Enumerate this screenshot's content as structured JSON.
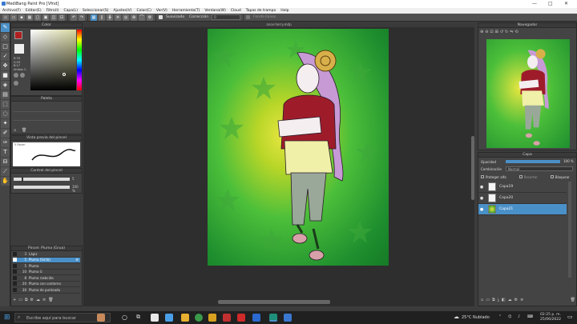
{
  "window": {
    "title": "MediBang Paint Pro [Vfnd]",
    "controls": [
      "—",
      "□",
      "✕"
    ]
  },
  "menu": [
    "Archivo(F)",
    "Editar(E)",
    "Filtro(I)",
    "Capa(L)",
    "Seleccionar(S)",
    "Ajustes(V)",
    "Color(C)",
    "Ver(V)",
    "Herramienta(T)",
    "Ventana(W)",
    "Cloud",
    "Tapas de trampo",
    "Help"
  ],
  "toolbar": {
    "suavizado_label": "Suavizado",
    "correccion_label": "Corrección",
    "correccion_value": "0",
    "fondo_label": "Fondo llanos"
  },
  "color_panel": {
    "title": "Color",
    "readouts": [
      "R:76",
      "G:33",
      "B:17"
    ],
    "alpha_label": "Ambos C."
  },
  "palette_panel": {
    "title": "Paleta"
  },
  "brush_preview_panel": {
    "title": "Vista previa del pincel",
    "size_label": "5 Raum"
  },
  "brush_control_panel": {
    "title": "Control del pincel",
    "size_value": "5",
    "opacity_value": "100 %"
  },
  "brush_list_panel": {
    "title": "Pincel: Pluma (Grua)",
    "items": [
      {
        "size": "3",
        "name": "Lápiz",
        "selected": false
      },
      {
        "size": "5",
        "name": "Pluma (Sirila)",
        "selected": true
      },
      {
        "size": "5",
        "name": "Pluma",
        "selected": false
      },
      {
        "size": "10",
        "name": "Pluma G",
        "selected": false
      },
      {
        "size": "8",
        "name": "Pluma rasbcida",
        "selected": false
      },
      {
        "size": "20",
        "name": "Pluma con contorno",
        "selected": false
      },
      {
        "size": "30",
        "name": "Pluma de punteado",
        "selected": false
      }
    ]
  },
  "document": {
    "tab": "anos-herry.mdp"
  },
  "navigator_panel": {
    "title": "Navegador"
  },
  "layer_panel": {
    "title": "Capa",
    "opacity_label": "Opacidad",
    "opacity_value": "100 %",
    "blend_label": "Combinación",
    "blend_value": "Normal",
    "protect_label": "Proteger alfa",
    "clip_label": "Recortar",
    "lock_label": "Bloquear",
    "layers": [
      {
        "name": "Capa19",
        "selected": false
      },
      {
        "name": "Capa20",
        "selected": false
      },
      {
        "name": "Capa21",
        "selected": true
      }
    ]
  },
  "taskbar": {
    "search_placeholder": "Escribe aquí para buscar",
    "weather": "25°C",
    "weather_desc": "Nublado",
    "time": "02:25 p. m.",
    "date": "25/06/2022"
  },
  "colors": {
    "accent": "#4a90c8",
    "foreground_swatch": "#b02020",
    "canvas_green": "#1e8f2e",
    "canvas_yellow": "#e8e640"
  }
}
